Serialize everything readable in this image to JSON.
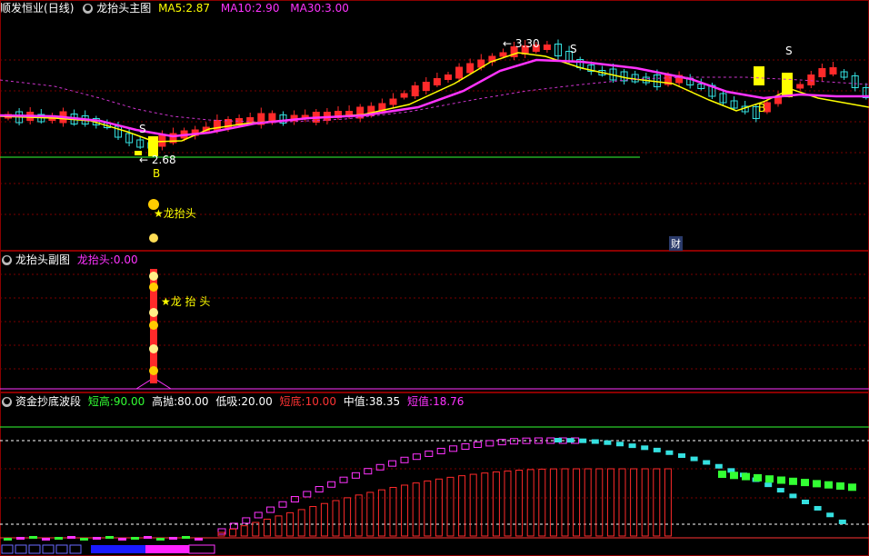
{
  "colors": {
    "up": "#ff2a2a",
    "down": "#35e0e0",
    "ma5": "#ffff00",
    "ma10": "#ff33ff",
    "ma30": "#cc33cc",
    "grid": "#7a0000",
    "support": "#33ff33",
    "white": "#ffffff"
  },
  "main": {
    "stock": "顺发恒业",
    "period": "(日线)",
    "indicator": "龙抬头主图",
    "ma5_label": "MA5:",
    "ma5_value": "2.87",
    "ma10_label": "MA10:",
    "ma10_value": "2.90",
    "ma30_label": "MA30:",
    "ma30_value": "3.00",
    "high_marker": "← 3.30",
    "low_marker": "← 2.68",
    "signal_s": "S",
    "signal_b": "B",
    "dragon_label": "★龙抬头",
    "finance_badge": "财"
  },
  "sub": {
    "indicator": "龙抬头副图",
    "value_label": "龙抬头:",
    "value": "0.00",
    "dragon_label": "★龙 抬 头"
  },
  "wave": {
    "indicator": "资金抄底波段",
    "items": [
      {
        "label": "短高:",
        "value": "90.00",
        "color": "#33ff33"
      },
      {
        "label": "高抛:",
        "value": "80.00",
        "color": "#ffffff"
      },
      {
        "label": "低吸:",
        "value": "20.00",
        "color": "#ffffff"
      },
      {
        "label": "短底:",
        "value": "10.00",
        "color": "#ff3333"
      },
      {
        "label": "中值:",
        "value": "38.35",
        "color": "#ffffff"
      },
      {
        "label": "短值:",
        "value": "18.76",
        "color": "#ff33ff"
      }
    ]
  }
}
